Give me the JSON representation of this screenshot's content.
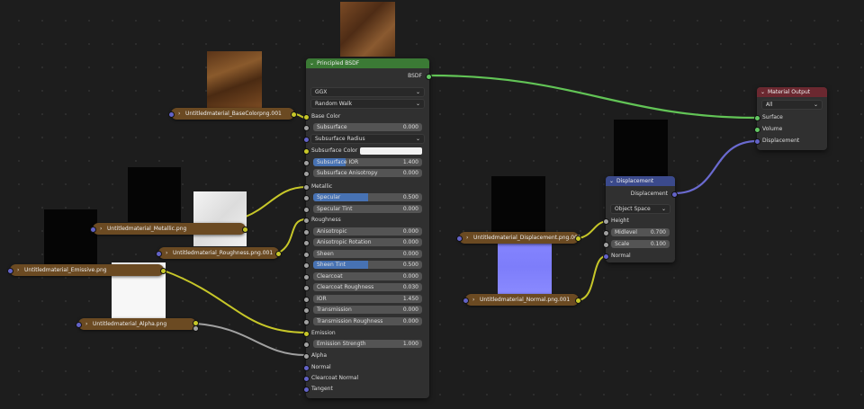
{
  "principled": {
    "title": "Principled BSDF",
    "output": "BSDF",
    "distribution": "GGX",
    "subsurface_method": "Random Walk",
    "base_color": "Base Color",
    "subsurface": {
      "label": "Subsurface",
      "value": "0.000"
    },
    "subsurface_radius": "Subsurface Radius",
    "subsurface_color": "Subsurface Color",
    "subsurface_ior": {
      "label": "Subsurface IOR",
      "value": "1.400"
    },
    "subsurface_anisotropy": {
      "label": "Subsurface Anisotropy",
      "value": "0.000"
    },
    "metallic": "Metallic",
    "specular": {
      "label": "Specular",
      "value": "0.500"
    },
    "specular_tint": {
      "label": "Specular Tint",
      "value": "0.000"
    },
    "roughness": "Roughness",
    "anisotropic": {
      "label": "Anisotropic",
      "value": "0.000"
    },
    "anisotropic_rotation": {
      "label": "Anisotropic Rotation",
      "value": "0.000"
    },
    "sheen": {
      "label": "Sheen",
      "value": "0.000"
    },
    "sheen_tint": {
      "label": "Sheen Tint",
      "value": "0.500"
    },
    "clearcoat": {
      "label": "Clearcoat",
      "value": "0.000"
    },
    "clearcoat_roughness": {
      "label": "Clearcoat Roughness",
      "value": "0.030"
    },
    "ior": {
      "label": "IOR",
      "value": "1.450"
    },
    "transmission": {
      "label": "Transmission",
      "value": "0.000"
    },
    "transmission_roughness": {
      "label": "Transmission Roughness",
      "value": "0.000"
    },
    "emission": "Emission",
    "emission_strength": {
      "label": "Emission Strength",
      "value": "1.000"
    },
    "alpha": "Alpha",
    "normal": "Normal",
    "clearcoat_normal": "Clearcoat Normal",
    "tangent": "Tangent",
    "bars": {
      "subsurface_ior": 0.3,
      "specular": 0.5,
      "sheen_tint": 0.5
    }
  },
  "material_output": {
    "title": "Material Output",
    "target": "All",
    "surface": "Surface",
    "volume": "Volume",
    "displacement": "Displacement"
  },
  "displacement": {
    "title": "Displacement",
    "output": "Displacement",
    "space": "Object Space",
    "height": "Height",
    "midlevel": {
      "label": "Midlevel",
      "value": "0.700"
    },
    "scale": {
      "label": "Scale",
      "value": "0.100"
    },
    "normal": "Normal"
  },
  "textures": {
    "basecolor": "Untitledmaterial_BaseColorpng.001",
    "metallic": "Untitledmaterial_Metallic.png",
    "roughness": "Untitledmaterial_Roughness.png.001",
    "emissive": "Untitledmaterial_Emissive.png",
    "alpha": "Untitledmaterial_Alpha.png",
    "displacement": "Untitledmaterial_Displacement.png.001",
    "normal": "Untitledmaterial_Normal.png.001"
  },
  "icons": {
    "collapse": "chevron-down-icon",
    "expand": "chevron-right-icon",
    "dropdown": "dropdown-arrow-icon"
  },
  "colors": {
    "canvas": "#1d1d1d",
    "node_body": "#303030",
    "shader_header": "#3b7a35",
    "vector_header": "#3b4a8c",
    "output_header": "#6b2830",
    "texture_header": "#6b4a22",
    "socket_color": "#c7c729",
    "socket_float": "#a1a1a1",
    "socket_vector": "#6363c7",
    "socket_shader": "#63c763"
  }
}
